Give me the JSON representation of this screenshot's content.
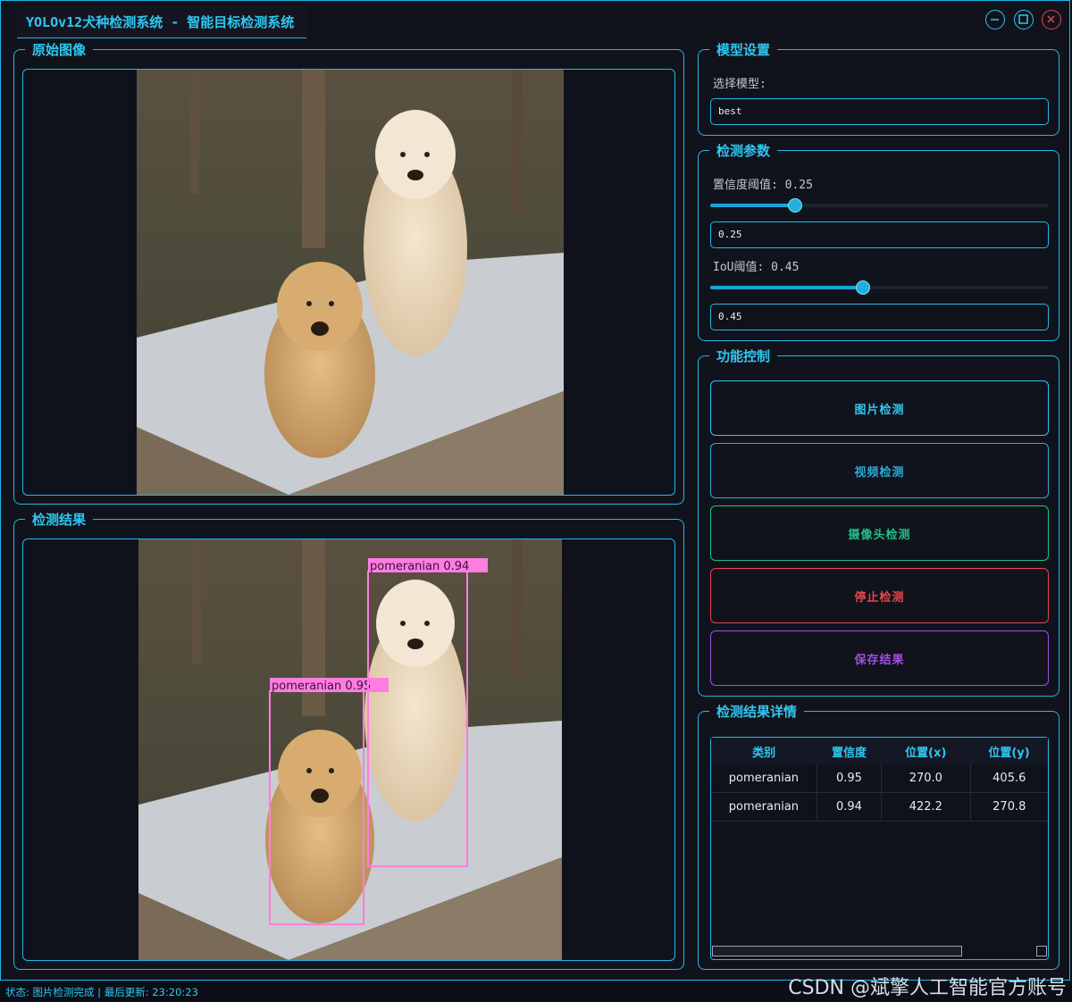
{
  "window": {
    "title": "YOLOv12犬种检测系统 - 智能目标检测系统"
  },
  "panels": {
    "original": {
      "title": "原始图像"
    },
    "result": {
      "title": "检测结果"
    }
  },
  "model": {
    "title": "模型设置",
    "select_label": "选择模型:",
    "selected": "best"
  },
  "params": {
    "title": "检测参数",
    "conf_label": "置信度阈值: 0.25",
    "conf_value": "0.25",
    "conf_fraction": 0.25,
    "iou_label": "IoU阈值: 0.45",
    "iou_value": "0.45",
    "iou_fraction": 0.45
  },
  "controls": {
    "title": "功能控制",
    "image_detect": "图片检测",
    "video_detect": "视频检测",
    "camera_detect": "摄像头检测",
    "stop_detect": "停止检测",
    "save_results": "保存结果"
  },
  "details": {
    "title": "检测结果详情",
    "columns": [
      "类别",
      "置信度",
      "位置(x)",
      "位置(y)"
    ],
    "rows": [
      [
        "pomeranian",
        "0.95",
        "270.0",
        "405.6"
      ],
      [
        "pomeranian",
        "0.94",
        "422.2",
        "270.8"
      ]
    ]
  },
  "detections": [
    {
      "label": "pomeranian 0.95"
    },
    {
      "label": "pomeranian 0.94"
    }
  ],
  "status": {
    "text": "状态: 图片检测完成 | 最后更新: 23:20:23"
  },
  "watermark": {
    "text": "CSDN @斌擎人工智能官方账号"
  },
  "colors": {
    "accent": "#1fb8e8",
    "image_btn": "#2fc7f0",
    "video_btn": "#2aaad8",
    "camera_btn": "#1fc08a",
    "stop_btn": "#e8454a",
    "save_btn": "#a04fe0",
    "bbox": "#ff7de0"
  }
}
